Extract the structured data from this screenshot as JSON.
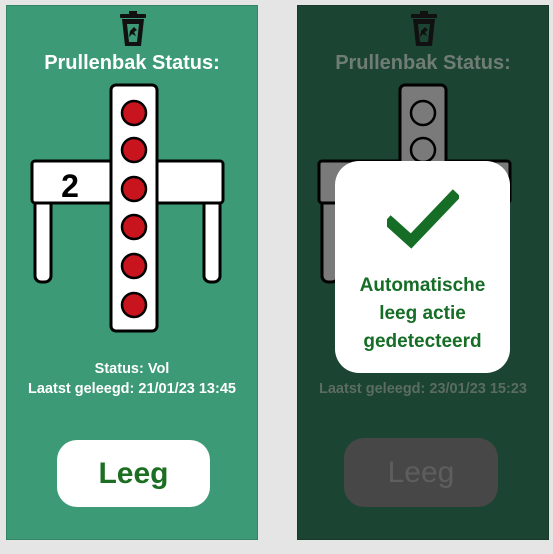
{
  "left_panel": {
    "title": "Prullenbak Status:",
    "icon": "trash-bin-icon",
    "counter": "2",
    "fill_level_indicators": 6,
    "status": "Status: Vol",
    "last_emptied": "Laatst geleegd: 21/01/23 13:45",
    "button_label": "Leeg"
  },
  "right_panel": {
    "title": "Prullenbak Status:",
    "icon": "trash-bin-icon",
    "last_emptied": "Laatst geleegd: 23/01/23 15:23",
    "button_label": "Leeg",
    "popup": {
      "icon": "checkmark-icon",
      "line1": "Automatische",
      "line2": "leeg actie",
      "line3": "gedetecteerd"
    }
  },
  "colors": {
    "left_bg": "#3d9a76",
    "right_bg": "#1c4433",
    "indicator_red": "#c8141c",
    "accent_green": "#166d26"
  }
}
